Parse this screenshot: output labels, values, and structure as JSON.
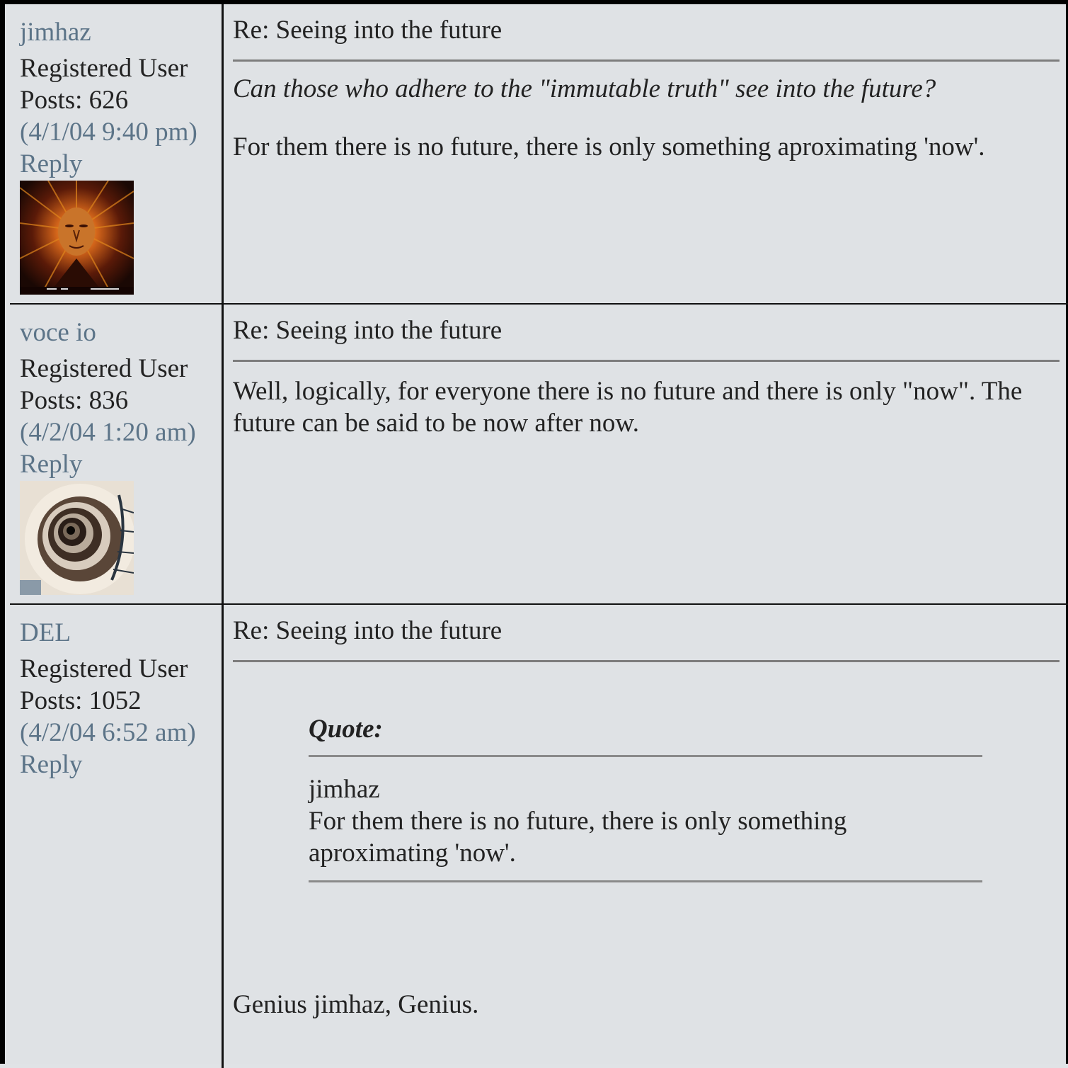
{
  "posts": [
    {
      "username": "jimhaz",
      "role": "Registered User",
      "posts_count": "Posts: 626",
      "timestamp": "(4/1/04 9:40 pm)",
      "reply_label": "Reply",
      "subject": "Re: Seeing into the future",
      "quoted_question": "Can those who adhere to the \"immutable truth\" see into the future?",
      "body": "For them there is no future, there is only something aproximating 'now'."
    },
    {
      "username": "voce io",
      "role": "Registered User",
      "posts_count": "Posts: 836",
      "timestamp": "(4/2/04 1:20 am)",
      "reply_label": "Reply",
      "subject": "Re: Seeing into the future",
      "body": "Well, logically, for everyone there is no future and there is only \"now\". The future can be said to be now after now."
    },
    {
      "username": "DEL",
      "role": "Registered User",
      "posts_count": "Posts: 1052",
      "timestamp": "(4/2/04 6:52 am)",
      "reply_label": "Reply",
      "subject": "Re: Seeing into the future",
      "quote_label": "Quote:",
      "quote_author": "jimhaz",
      "quote_text": "For them there is no future, there is only something aproximating 'now'.",
      "body": "Genius jimhaz, Genius."
    }
  ],
  "avatars": [
    "sun-face-avatar",
    "spiral-staircase-avatar"
  ]
}
